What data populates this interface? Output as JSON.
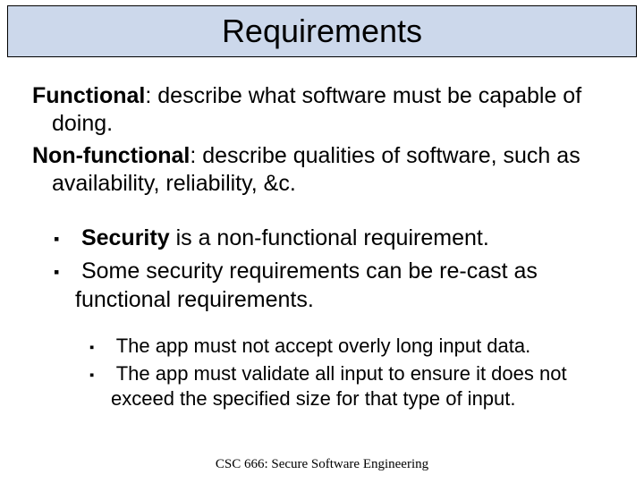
{
  "title": "Requirements",
  "defs": {
    "functional_label": "Functional",
    "functional_text": ": describe what software must be capable of doing.",
    "nonfunctional_label": "Non-functional",
    "nonfunctional_text": ": describe qualities of software, such as availability, reliability, &c."
  },
  "bullets": {
    "b1_bold": "Security",
    "b1_rest": " is a non-functional requirement.",
    "b2": "Some security requirements can be re-cast as functional requirements.",
    "sub1": "The app must not accept overly long input data.",
    "sub2": "The app must validate all input to ensure it does not exceed the specified size for that type of input."
  },
  "footer": "CSC 666: Secure Software Engineering"
}
